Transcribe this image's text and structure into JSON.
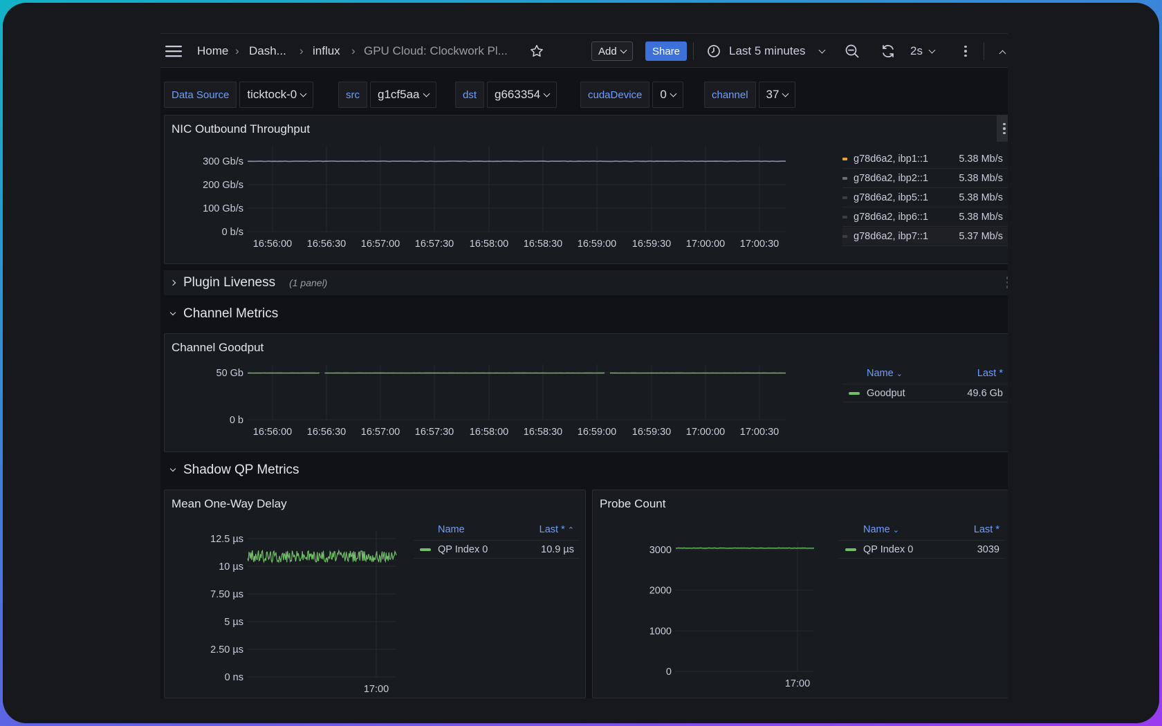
{
  "breadcrumb": {
    "items": [
      "Home",
      "Dash...",
      "influx",
      "GPU Cloud: Clockwork Pl..."
    ]
  },
  "toolbar": {
    "add_label": "Add",
    "share_label": "Share",
    "time_range": "Last 5 minutes",
    "refresh_interval": "2s"
  },
  "variables": [
    {
      "label": "Data Source",
      "value": "ticktock-0"
    },
    {
      "label": "src",
      "value": "g1cf5aa"
    },
    {
      "label": "dst",
      "value": "g663354"
    },
    {
      "label": "cudaDevice",
      "value": "0"
    },
    {
      "label": "channel",
      "value": "37"
    }
  ],
  "panels": {
    "nic": {
      "title": "NIC Outbound Throughput",
      "legend": [
        {
          "name": "g78d6a2, ibp1::1",
          "value": "5.38 Mb/s",
          "color": "#e0a53a"
        },
        {
          "name": "g78d6a2, ibp2::1",
          "value": "5.38 Mb/s",
          "color": "#6b6d78"
        },
        {
          "name": "g78d6a2, ibp5::1",
          "value": "5.38 Mb/s",
          "color": "#3c3e47"
        },
        {
          "name": "g78d6a2, ibp6::1",
          "value": "5.38 Mb/s",
          "color": "#3c3e47"
        },
        {
          "name": "g78d6a2, ibp7::1",
          "value": "5.37 Mb/s",
          "color": "#3c3e47"
        }
      ]
    },
    "plugin_row": {
      "title": "Plugin Liveness",
      "note": "(1 panel)"
    },
    "channel_row": {
      "title": "Channel Metrics"
    },
    "goodput": {
      "title": "Channel Goodput",
      "legend_header": {
        "name": "Name",
        "last": "Last *"
      },
      "legend": [
        {
          "name": "Goodput",
          "value": "49.6 Gb",
          "color": "#73bf69"
        }
      ]
    },
    "shadow_row": {
      "title": "Shadow QP Metrics"
    },
    "delay": {
      "title": "Mean One-Way Delay",
      "legend_header": {
        "name": "Name",
        "last": "Last *"
      },
      "legend": [
        {
          "name": "QP Index 0",
          "value": "10.9 µs",
          "color": "#73bf69"
        }
      ]
    },
    "probe": {
      "title": "Probe Count",
      "legend_header": {
        "name": "Name",
        "last": "Last *"
      },
      "legend": [
        {
          "name": "QP Index 0",
          "value": "3039",
          "color": "#73bf69"
        }
      ]
    }
  },
  "colors": {
    "accent": "#3d71d9",
    "series_green": "#73bf69",
    "link_blue": "#6e9fff"
  },
  "chart_data": [
    {
      "type": "line",
      "title": "NIC Outbound Throughput",
      "ytick_labels": [
        "300 Gb/s",
        "200 Gb/s",
        "100 Gb/s",
        "0 b/s"
      ],
      "yticks": [
        300,
        200,
        100,
        0
      ],
      "ylim": [
        0,
        330
      ],
      "xtick_labels": [
        "16:56:00",
        "16:56:30",
        "16:57:00",
        "16:57:30",
        "16:58:00",
        "16:58:30",
        "16:59:00",
        "16:59:30",
        "17:00:00",
        "17:00:30"
      ],
      "x_minutes": [
        0,
        5.6
      ],
      "series": [
        {
          "values_const": 300
        }
      ],
      "grid": true,
      "legend_position": "right"
    },
    {
      "type": "line",
      "title": "Channel Goodput",
      "ytick_labels": [
        "50 Gb",
        "0 b"
      ],
      "yticks": [
        50,
        0
      ],
      "ylim": [
        0,
        50
      ],
      "xtick_labels": [
        "16:56:00",
        "16:56:30",
        "16:57:00",
        "16:57:30",
        "16:58:00",
        "16:58:30",
        "16:59:00",
        "16:59:30",
        "17:00:00",
        "17:00:30"
      ],
      "series": [
        {
          "name": "Goodput",
          "values_const": 49.6
        }
      ],
      "grid": true,
      "legend_position": "right"
    },
    {
      "type": "line",
      "title": "Mean One-Way Delay",
      "ytick_labels": [
        "12.5 µs",
        "10 µs",
        "7.50 µs",
        "5 µs",
        "2.50 µs",
        "0 ns"
      ],
      "yticks": [
        12.5,
        10,
        7.5,
        5,
        2.5,
        0
      ],
      "ylim": [
        0,
        12.5
      ],
      "xtick_labels": [
        "17:00"
      ],
      "series": [
        {
          "name": "QP Index 0",
          "values_const": 10.9
        }
      ],
      "grid": true,
      "legend_position": "right"
    },
    {
      "type": "line",
      "title": "Probe Count",
      "ytick_labels": [
        "3000",
        "2000",
        "1000",
        "0"
      ],
      "yticks": [
        3000,
        2000,
        1000,
        0
      ],
      "ylim": [
        0,
        3000
      ],
      "xtick_labels": [
        "17:00"
      ],
      "series": [
        {
          "name": "QP Index 0",
          "values_const": 3039
        }
      ],
      "grid": true,
      "legend_position": "right"
    }
  ]
}
